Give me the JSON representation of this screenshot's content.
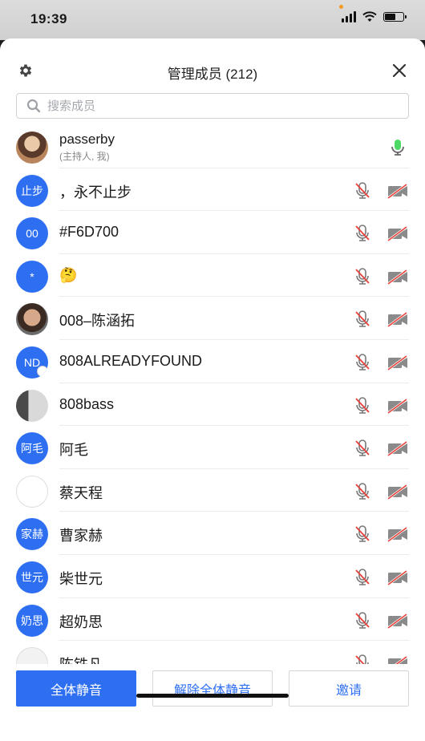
{
  "status_bar": {
    "time": "19:39"
  },
  "header": {
    "title": "管理成员 (212)"
  },
  "search": {
    "placeholder": "搜索成员"
  },
  "members": [
    {
      "name": "passerby",
      "subtitle": "(主持人, 我)",
      "avatar_type": "photo1",
      "avatar_text": "",
      "mic": "on",
      "cam": "none"
    },
    {
      "name": "，永不止步",
      "avatar_type": "text",
      "avatar_text": "止步",
      "mic": "off",
      "cam": "off"
    },
    {
      "name": "#F6D700",
      "avatar_type": "text",
      "avatar_text": "00",
      "mic": "off",
      "cam": "off"
    },
    {
      "name": "🤔",
      "avatar_type": "text",
      "avatar_text": "*",
      "mic": "off",
      "cam": "off"
    },
    {
      "name": "008–陈涵拓",
      "avatar_type": "photo2",
      "avatar_text": "",
      "mic": "off",
      "cam": "off"
    },
    {
      "name": "808ALREADYFOUND",
      "avatar_type": "text",
      "avatar_text": "ND",
      "mic": "off",
      "cam": "off"
    },
    {
      "name": "808bass",
      "avatar_type": "photo3",
      "avatar_text": "",
      "mic": "off",
      "cam": "off"
    },
    {
      "name": "阿毛",
      "avatar_type": "text",
      "avatar_text": "阿毛",
      "mic": "off",
      "cam": "off"
    },
    {
      "name": "蔡天程",
      "avatar_type": "photo4",
      "avatar_text": "",
      "mic": "off",
      "cam": "off"
    },
    {
      "name": "曹家赫",
      "avatar_type": "text",
      "avatar_text": "家赫",
      "mic": "off",
      "cam": "off"
    },
    {
      "name": "柴世元",
      "avatar_type": "text",
      "avatar_text": "世元",
      "mic": "off",
      "cam": "off"
    },
    {
      "name": "超奶思",
      "avatar_type": "text",
      "avatar_text": "奶思",
      "mic": "off",
      "cam": "off"
    },
    {
      "name": "陈铁凡",
      "avatar_type": "photo5",
      "avatar_text": "",
      "mic": "off",
      "cam": "off"
    }
  ],
  "footer": {
    "mute_all": "全体静音",
    "unmute_all": "解除全体静音",
    "invite": "邀请"
  },
  "colors": {
    "accent": "#2e6ff2",
    "mic_active": "#4cd964",
    "muted_red": "#e8413a"
  }
}
